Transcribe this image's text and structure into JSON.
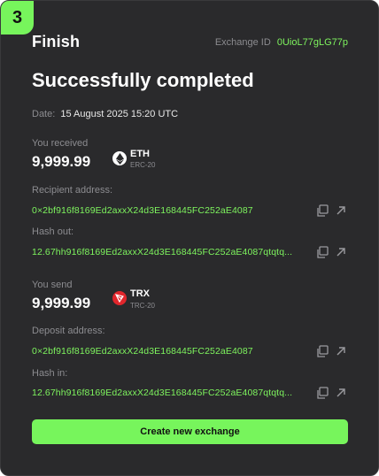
{
  "step": {
    "number": "3"
  },
  "header": {
    "title": "Finish",
    "exchange_id_label": "Exchange ID",
    "exchange_id_value": "0UioL77gLG77p"
  },
  "status": {
    "headline": "Successfully completed"
  },
  "date": {
    "label": "Date:",
    "value": "15 August 2025 15:20 UTC"
  },
  "received": {
    "label": "You received",
    "amount": "9,999.99",
    "coin": {
      "symbol": "ETH",
      "network": "ERC-20",
      "icon": "ethereum-icon"
    },
    "recipient_label": "Recipient address:",
    "recipient_address": "0×2bf916f8169Ed2axxX24d3E168445FC252aE4087",
    "hash_label": "Hash out:",
    "hash_value": "12.67hh916f8169Ed2axxX24d3E168445FC252aE4087qtqtq..."
  },
  "sent": {
    "label": "You send",
    "amount": "9,999.99",
    "coin": {
      "symbol": "TRX",
      "network": "TRC-20",
      "icon": "tron-icon"
    },
    "deposit_label": "Deposit address:",
    "deposit_address": "0×2bf916f8169Ed2axxX24d3E168445FC252aE4087",
    "hash_label": "Hash in:",
    "hash_value": "12.67hh916f8169Ed2axxX24d3E168445FC252aE4087qtqtq..."
  },
  "actions": {
    "create_new_exchange": "Create new exchange"
  },
  "colors": {
    "accent": "#77f55c",
    "background": "#2a2a2c",
    "muted_text": "#8c8c90",
    "tron_red": "#e1262c"
  }
}
